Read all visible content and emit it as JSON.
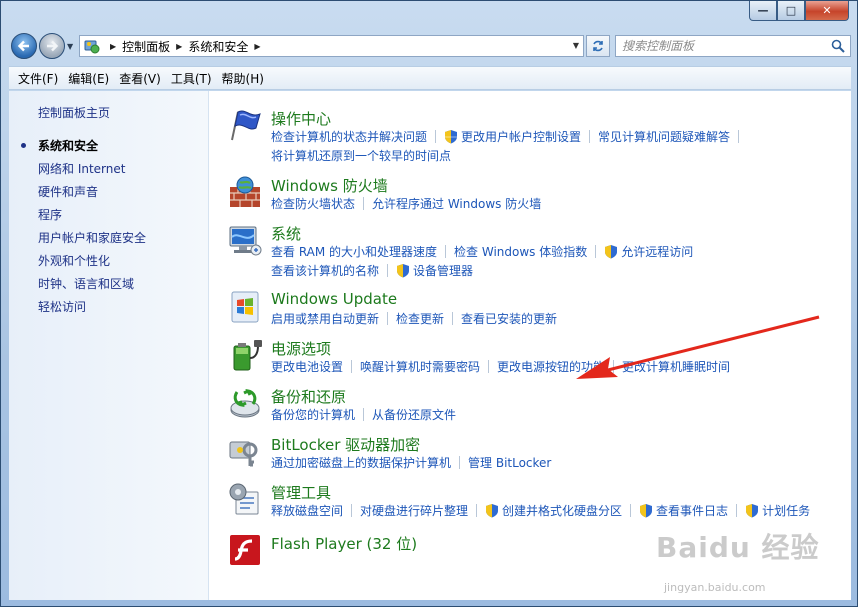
{
  "window": {
    "caption_buttons": {
      "minimize": "—",
      "maximize": "□",
      "close": "✕"
    }
  },
  "nav": {
    "breadcrumb": [
      "控制面板",
      "系统和安全"
    ],
    "search_placeholder": "搜索控制面板"
  },
  "menu": [
    "文件(F)",
    "编辑(E)",
    "查看(V)",
    "工具(T)",
    "帮助(H)"
  ],
  "sidebar": {
    "items": [
      {
        "label": "控制面板主页",
        "current": false
      },
      {
        "label": "系统和安全",
        "current": true
      },
      {
        "label": "网络和 Internet",
        "current": false
      },
      {
        "label": "硬件和声音",
        "current": false
      },
      {
        "label": "程序",
        "current": false
      },
      {
        "label": "用户帐户和家庭安全",
        "current": false
      },
      {
        "label": "外观和个性化",
        "current": false
      },
      {
        "label": "时钟、语言和区域",
        "current": false
      },
      {
        "label": "轻松访问",
        "current": false
      }
    ]
  },
  "categories": [
    {
      "title": "操作中心",
      "icon": "action-center-flag-icon",
      "lines": [
        [
          {
            "label": "检查计算机的状态并解决问题",
            "shield": false
          },
          {
            "label": "更改用户帐户控制设置",
            "shield": true
          },
          {
            "label": "常见计算机问题疑难解答",
            "shield": false
          }
        ],
        [
          {
            "label": "将计算机还原到一个较早的时间点",
            "shield": false
          }
        ]
      ]
    },
    {
      "title": "Windows 防火墙",
      "icon": "firewall-icon",
      "lines": [
        [
          {
            "label": "检查防火墙状态",
            "shield": false
          },
          {
            "label": "允许程序通过 Windows 防火墙",
            "shield": false
          }
        ]
      ]
    },
    {
      "title": "系统",
      "icon": "system-computer-icon",
      "lines": [
        [
          {
            "label": "查看 RAM 的大小和处理器速度",
            "shield": false
          },
          {
            "label": "检查 Windows 体验指数",
            "shield": false
          },
          {
            "label": "允许远程访问",
            "shield": true
          }
        ],
        [
          {
            "label": "查看该计算机的名称",
            "shield": false
          },
          {
            "label": "设备管理器",
            "shield": true
          }
        ]
      ]
    },
    {
      "title": "Windows Update",
      "icon": "windows-update-icon",
      "lines": [
        [
          {
            "label": "启用或禁用自动更新",
            "shield": false
          },
          {
            "label": "检查更新",
            "shield": false
          },
          {
            "label": "查看已安装的更新",
            "shield": false
          }
        ]
      ]
    },
    {
      "title": "电源选项",
      "icon": "power-battery-icon",
      "lines": [
        [
          {
            "label": "更改电池设置",
            "shield": false
          },
          {
            "label": "唤醒计算机时需要密码",
            "shield": false
          },
          {
            "label": "更改电源按钮的功能",
            "shield": false
          },
          {
            "label": "更改计算机睡眠时间",
            "shield": false
          }
        ]
      ]
    },
    {
      "title": "备份和还原",
      "icon": "backup-restore-icon",
      "lines": [
        [
          {
            "label": "备份您的计算机",
            "shield": false
          },
          {
            "label": "从备份还原文件",
            "shield": false
          }
        ]
      ]
    },
    {
      "title": "BitLocker 驱动器加密",
      "icon": "bitlocker-keys-icon",
      "lines": [
        [
          {
            "label": "通过加密磁盘上的数据保护计算机",
            "shield": false
          },
          {
            "label": "管理 BitLocker",
            "shield": false
          }
        ]
      ]
    },
    {
      "title": "管理工具",
      "icon": "admin-tools-icon",
      "lines": [
        [
          {
            "label": "释放磁盘空间",
            "shield": false
          },
          {
            "label": "对硬盘进行碎片整理",
            "shield": false
          },
          {
            "label": "创建并格式化硬盘分区",
            "shield": true
          },
          {
            "label": "查看事件日志",
            "shield": true
          },
          {
            "label": "计划任务",
            "shield": true
          }
        ]
      ]
    },
    {
      "title": "Flash Player (32 位)",
      "icon": "flash-player-icon",
      "lines": []
    }
  ],
  "watermark": {
    "text": "Baidu 经验",
    "url": "jingyan.baidu.com"
  }
}
